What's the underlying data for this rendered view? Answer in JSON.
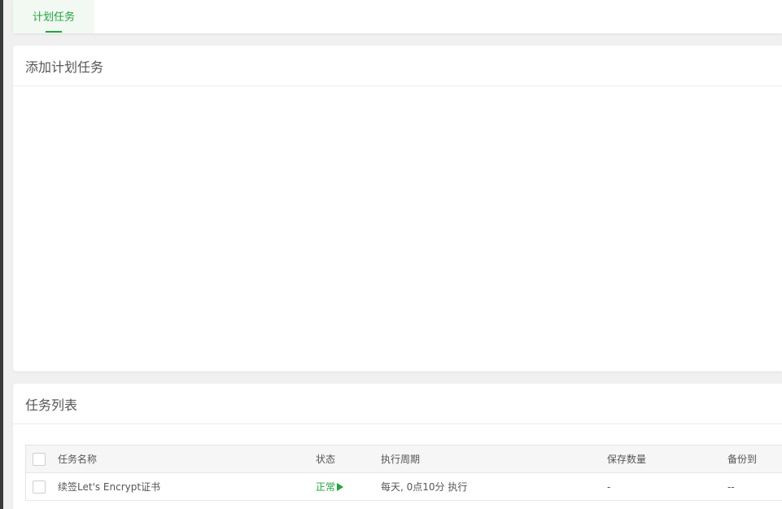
{
  "tabs": [
    {
      "label": "计划任务",
      "active": true
    }
  ],
  "add_task": {
    "title": "添加计划任务"
  },
  "task_list": {
    "title": "任务列表",
    "columns": [
      "任务名称",
      "状态",
      "执行周期",
      "保存数量",
      "备份到"
    ],
    "rows": [
      {
        "name": "续签Let's Encrypt证书",
        "status": "正常",
        "status_icon": "play-icon",
        "cycle": "每天, 0点10分 执行",
        "save_count": "-",
        "backup_to": "--"
      }
    ]
  },
  "colors": {
    "accent": "#20a53a",
    "page_bg": "#f0f0f0",
    "header_bg": "#f6f6f6"
  }
}
